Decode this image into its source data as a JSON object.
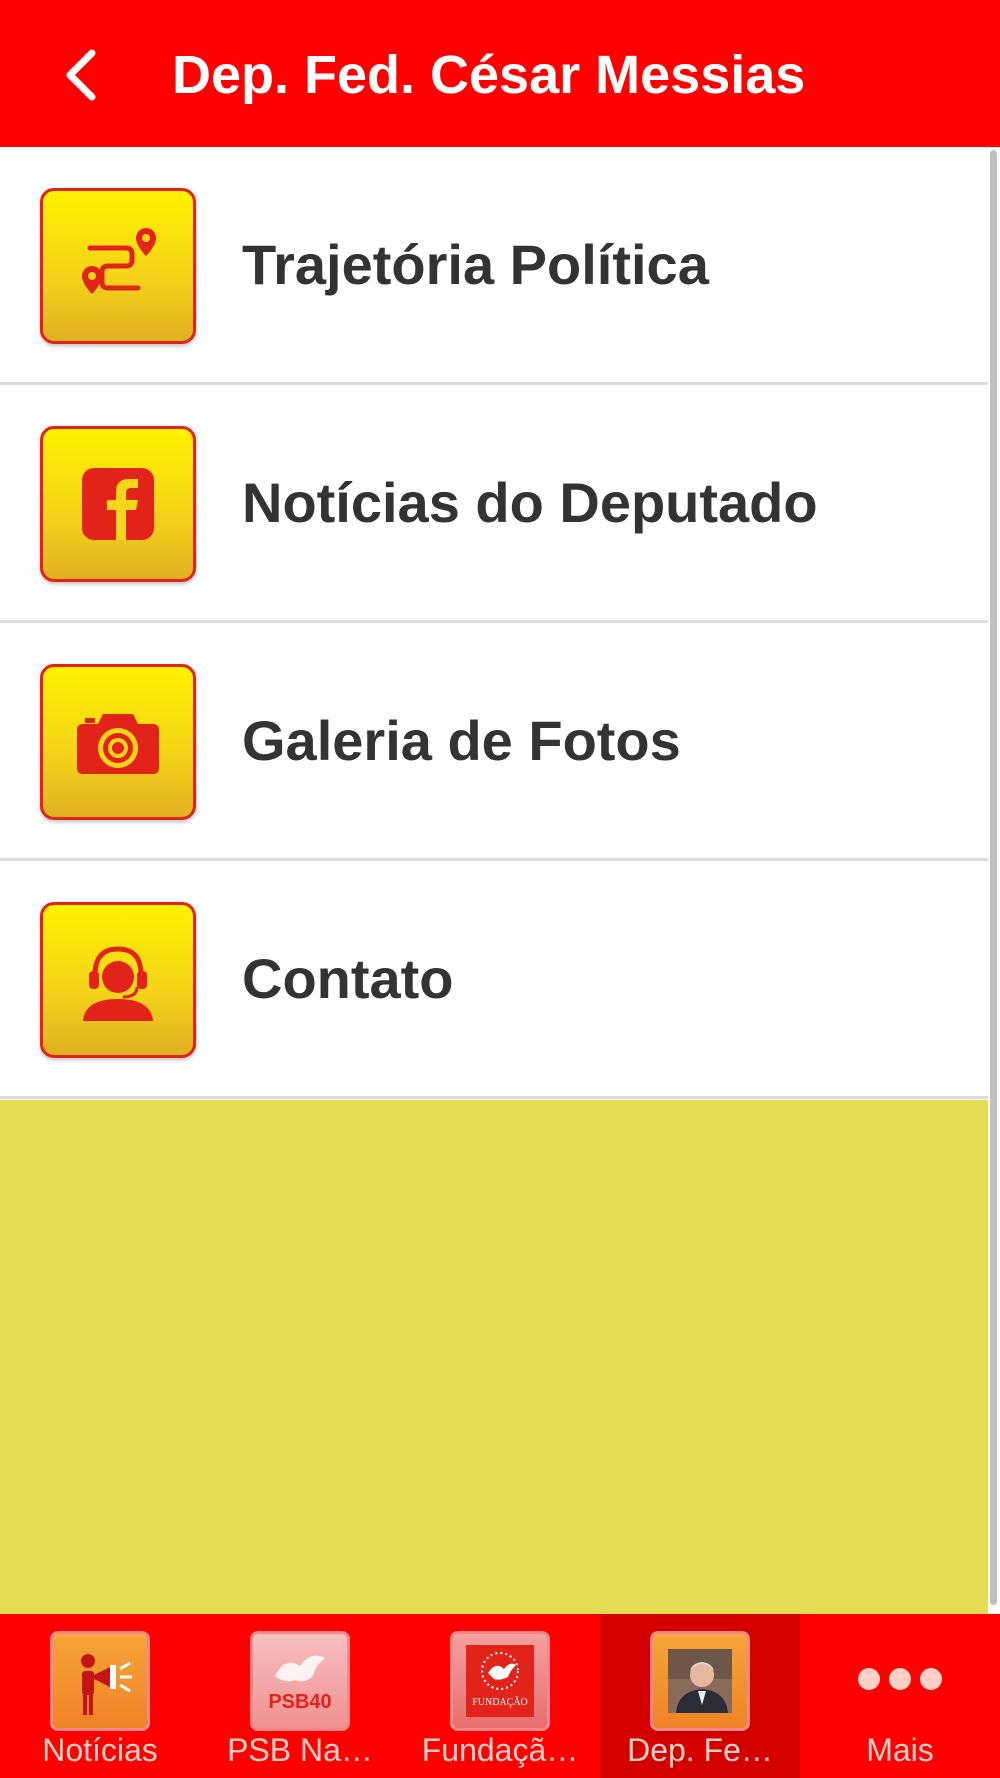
{
  "header": {
    "title": "Dep. Fed. César Messias",
    "back_icon": "chevron-left-icon"
  },
  "colors": {
    "header_bg": "#ff0000",
    "tile_top": "#fff200",
    "tile_bottom": "#e0b022",
    "icon_red": "#e2231a",
    "empty_bg": "#e2dd52",
    "text": "#333333"
  },
  "menu": {
    "items": [
      {
        "label": "Trajetória Política",
        "icon": "route-map-icon"
      },
      {
        "label": "Notícias do Deputado",
        "icon": "facebook-icon"
      },
      {
        "label": "Galeria de Fotos",
        "icon": "camera-icon"
      },
      {
        "label": "Contato",
        "icon": "headset-person-icon"
      }
    ]
  },
  "tabbar": {
    "tabs": [
      {
        "label": "Notícias",
        "icon": "megaphone-icon"
      },
      {
        "label": "PSB Na…",
        "icon": "psb-logo-icon",
        "logo_text": "PSB40"
      },
      {
        "label": "Fundaçã…",
        "icon": "fundacao-logo-icon",
        "logo_text": "FUNDAÇÃO"
      },
      {
        "label": "Dep. Fe…",
        "icon": "deputy-photo-icon",
        "active": true
      },
      {
        "label": "Mais",
        "icon": "more-dots-icon"
      }
    ]
  }
}
